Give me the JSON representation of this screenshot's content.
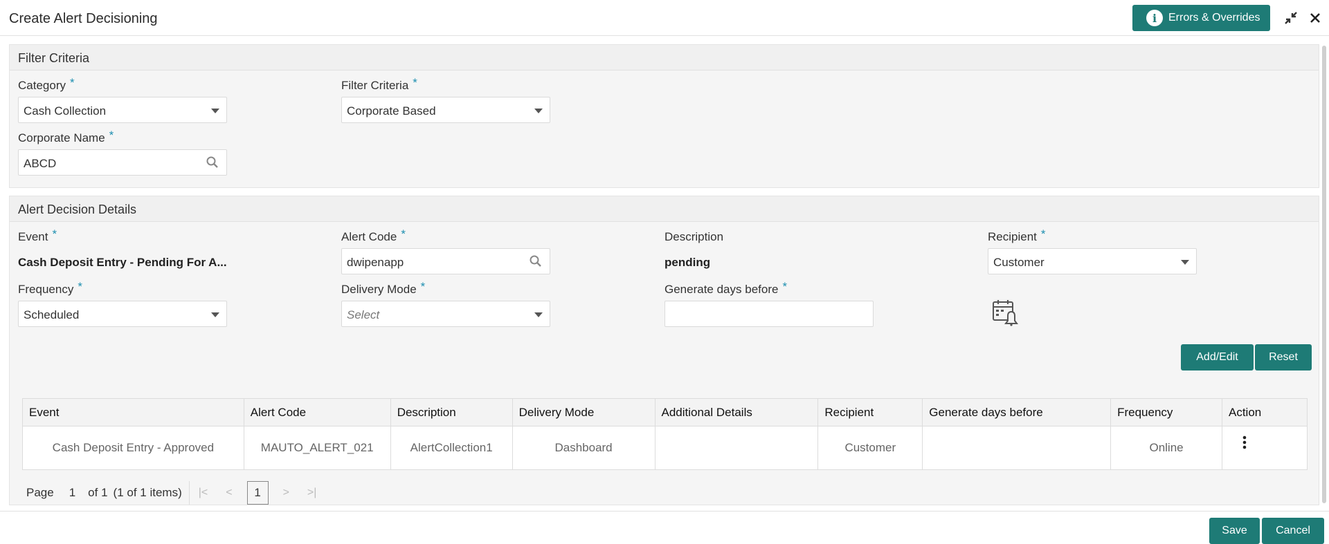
{
  "window": {
    "title": "Create Alert Decisioning",
    "errors_button": "Errors & Overrides"
  },
  "filter": {
    "section_title": "Filter Criteria",
    "category_label": "Category",
    "category_value": "Cash Collection",
    "criteria_label": "Filter Criteria",
    "criteria_value": "Corporate Based",
    "corporate_label": "Corporate Name",
    "corporate_value": "ABCD",
    "required_mark": "*"
  },
  "details": {
    "section_title": "Alert Decision Details",
    "event_label": "Event",
    "event_value": "Cash Deposit Entry - Pending For A...",
    "alert_code_label": "Alert Code",
    "alert_code_value": "dwipenapp",
    "description_label": "Description",
    "description_value": "pending",
    "recipient_label": "Recipient",
    "recipient_value": "Customer",
    "frequency_label": "Frequency",
    "frequency_value": "Scheduled",
    "delivery_label": "Delivery Mode",
    "delivery_placeholder": "Select",
    "generate_label": "Generate days before",
    "generate_value": "",
    "add_edit": "Add/Edit",
    "reset": "Reset"
  },
  "table": {
    "headers": [
      "Event",
      "Alert Code",
      "Description",
      "Delivery Mode",
      "Additional Details",
      "Recipient",
      "Generate days before",
      "Frequency",
      "Action"
    ],
    "rows": [
      [
        "Cash Deposit Entry - Approved",
        "MAUTO_ALERT_021",
        "AlertCollection1",
        "Dashboard",
        "",
        "Customer",
        "",
        "Online",
        ""
      ]
    ]
  },
  "pager": {
    "page_label": "Page",
    "page": "1",
    "of": "of 1",
    "items": "(1 of 1 items)",
    "current": "1"
  },
  "footer": {
    "save": "Save",
    "cancel": "Cancel"
  },
  "colors": {
    "accent": "#1e7b76",
    "required": "#1e8fb0"
  }
}
